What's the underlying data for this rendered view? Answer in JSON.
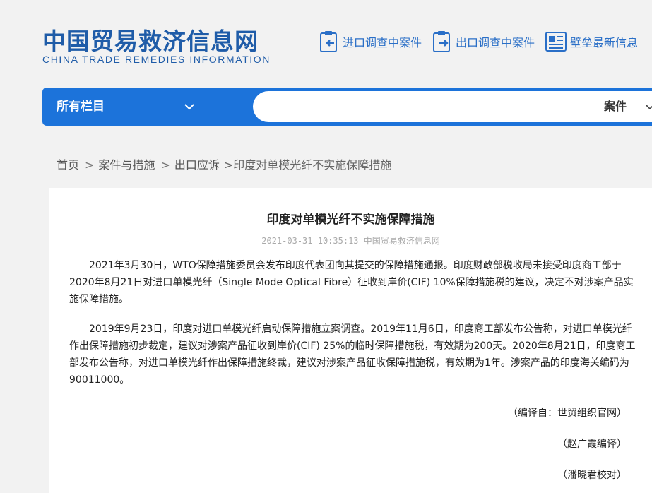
{
  "site": {
    "name_cn": "中国贸易救济信息网",
    "name_en": "CHINA TRADE REMEDIES INFORMATION"
  },
  "top_links": [
    {
      "label": "进口调查中案件",
      "icon": "import-case-icon"
    },
    {
      "label": "出口调查中案件",
      "icon": "export-case-icon"
    },
    {
      "label": "壁垒最新信息",
      "icon": "barrier-news-icon"
    }
  ],
  "nav": {
    "all_columns_label": "所有栏目",
    "search_value": "",
    "search_type": "案件"
  },
  "breadcrumb": {
    "home": "首页",
    "level1": "案件与措施",
    "level2": "出口应诉",
    "current": ">印度对单模光纤不实施保障措施"
  },
  "article": {
    "title": "印度对单模光纤不实施保障措施",
    "meta": "2021-03-31 10:35:13 中国贸易救济信息网",
    "paragraphs": [
      "2021年3月30日，WTO保障措施委员会发布印度代表团向其提交的保障措施通报。印度财政部税收局未接受印度商工部于2020年8月21日对进口单模光纤（Single Mode Optical Fibre）征收到岸价(CIF) 10%保障措施税的建议，决定不对涉案产品实施保障措施。",
      "2019年9月23日，印度对进口单模光纤启动保障措施立案调查。2019年11月6日，印度商工部发布公告称，对进口单模光纤作出保障措施初步裁定，建议对涉案产品征收到岸价(CIF) 25%的临时保障措施税，有效期为200天。2020年8月21日，印度商工部发布公告称，对进口单模光纤作出保障措施终裁，建议对涉案产品征收保障措施税，有效期为1年。涉案产品的印度海关编码为90011000。"
    ],
    "credits": [
      "（编译自：世贸组织官网）",
      "（赵广霞编译）",
      "（潘晓君校对）"
    ]
  },
  "colors": {
    "brand_blue": "#1f5ca8",
    "nav_blue": "#1c73da",
    "link_blue": "#2a6fc7",
    "background": "#f2f2f2"
  }
}
